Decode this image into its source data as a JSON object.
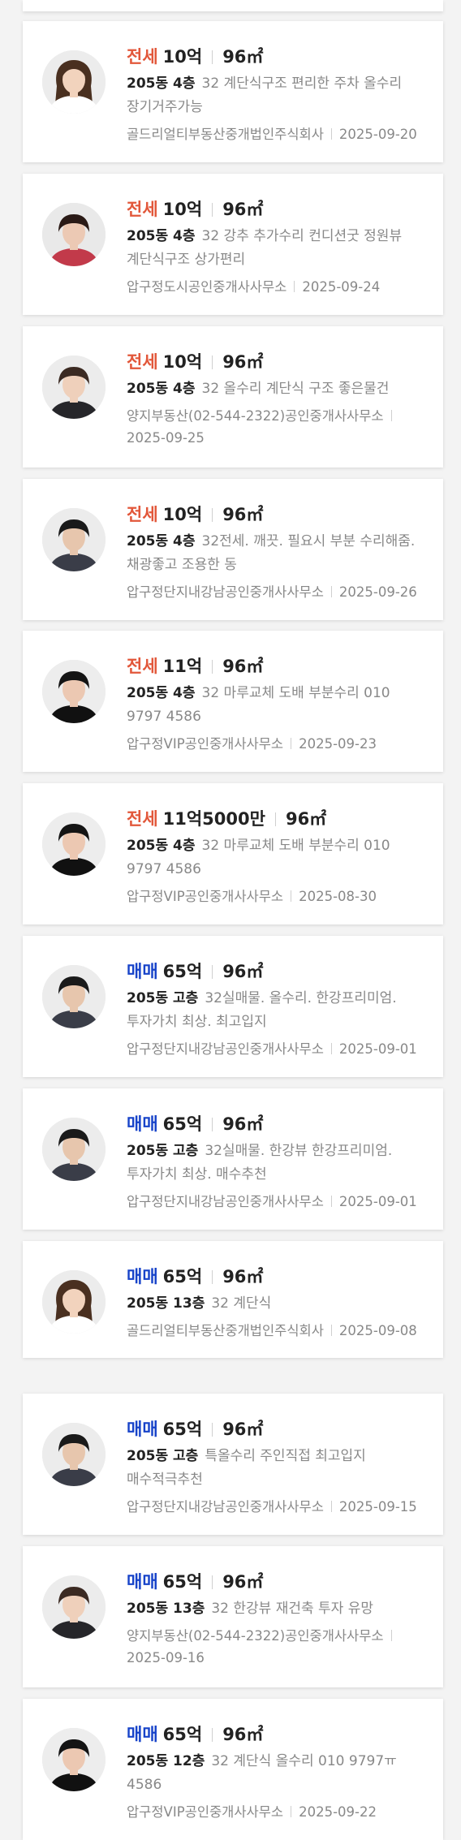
{
  "listings": [
    {
      "trade_type": "전세",
      "trade_kind": "jeonse",
      "price": "10억",
      "area": "96㎡",
      "floor": "205동 4층",
      "description": "32 계단식구조 편리한 주차 올수리 장기거주가능",
      "agency": "골드리얼티부동산중개법인주식회사",
      "date": "2025-09-20",
      "avatar": {
        "hair": "#4a3020",
        "skin": "#f2d3bd",
        "clothes": "#ffffff",
        "bg": "#ececec",
        "long_hair": true
      }
    },
    {
      "trade_type": "전세",
      "trade_kind": "jeonse",
      "price": "10억",
      "area": "96㎡",
      "floor": "205동 4층",
      "description": "32 강추 추가수리 컨디션굿 정원뷰 계단식구조 상가편리",
      "agency": "압구정도시공인중개사사무소",
      "date": "2025-09-24",
      "avatar": {
        "hair": "#2a1a16",
        "skin": "#ecc9b4",
        "clothes": "#c23a4a",
        "bg": "#e9e9e9",
        "long_hair": false
      }
    },
    {
      "trade_type": "전세",
      "trade_kind": "jeonse",
      "price": "10억",
      "area": "96㎡",
      "floor": "205동 4층",
      "description": "32 올수리 계단식 구조 좋은물건",
      "agency": "양지부동산(02-544-2322)공인중개사사무소",
      "date": "2025-09-25",
      "avatar": {
        "hair": "#3b2a22",
        "skin": "#efd0bb",
        "clothes": "#26262a",
        "bg": "#ececec",
        "long_hair": false
      }
    },
    {
      "trade_type": "전세",
      "trade_kind": "jeonse",
      "price": "10억",
      "area": "96㎡",
      "floor": "205동 4층",
      "description": "32전세. 깨끗. 필요시 부분 수리해줌. 채광좋고 조용한 동",
      "agency": "압구정단지내강남공인중개사사무소",
      "date": "2025-09-26",
      "avatar": {
        "hair": "#1a1a1a",
        "skin": "#e7c6ad",
        "clothes": "#3a3d48",
        "bg": "#ececec",
        "long_hair": false
      }
    },
    {
      "trade_type": "전세",
      "trade_kind": "jeonse",
      "price": "11억",
      "area": "96㎡",
      "floor": "205동 4층",
      "description": "32 마루교체 도배 부분수리 010 9797 4586",
      "agency": "압구정VIP공인중개사사무소",
      "date": "2025-09-23",
      "avatar": {
        "hair": "#141414",
        "skin": "#ecc8b2",
        "clothes": "#111111",
        "bg": "#ededed",
        "long_hair": false
      }
    },
    {
      "trade_type": "전세",
      "trade_kind": "jeonse",
      "price": "11억5000만",
      "area": "96㎡",
      "floor": "205동 4층",
      "description": "32 마루교체 도배 부분수리 010 9797 4586",
      "agency": "압구정VIP공인중개사사무소",
      "date": "2025-08-30",
      "avatar": {
        "hair": "#141414",
        "skin": "#ecc8b2",
        "clothes": "#111111",
        "bg": "#ededed",
        "long_hair": false
      }
    },
    {
      "trade_type": "매매",
      "trade_kind": "maemae",
      "price": "65억",
      "area": "96㎡",
      "floor": "205동 고층",
      "description": "32실매물. 올수리. 한강프리미엄. 투자가치 최상. 최고입지",
      "agency": "압구정단지내강남공인중개사사무소",
      "date": "2025-09-01",
      "avatar": {
        "hair": "#1a1a1a",
        "skin": "#e7c6ad",
        "clothes": "#3a3d48",
        "bg": "#ececec",
        "long_hair": false
      }
    },
    {
      "trade_type": "매매",
      "trade_kind": "maemae",
      "price": "65억",
      "area": "96㎡",
      "floor": "205동 고층",
      "description": "32실매물. 한강뷰 한강프리미엄. 투자가치 최상. 매수추천",
      "agency": "압구정단지내강남공인중개사사무소",
      "date": "2025-09-01",
      "avatar": {
        "hair": "#1a1a1a",
        "skin": "#e7c6ad",
        "clothes": "#3a3d48",
        "bg": "#ececec",
        "long_hair": false
      }
    },
    {
      "trade_type": "매매",
      "trade_kind": "maemae",
      "price": "65억",
      "area": "96㎡",
      "floor": "205동 13층",
      "description": "32 계단식",
      "agency": "골드리얼티부동산중개법인주식회사",
      "date": "2025-09-08",
      "avatar": {
        "hair": "#4a3020",
        "skin": "#f2d3bd",
        "clothes": "#ffffff",
        "bg": "#ececec",
        "long_hair": true
      }
    },
    {
      "trade_type": "매매",
      "trade_kind": "maemae",
      "price": "65억",
      "area": "96㎡",
      "floor": "205동 고층",
      "description": "특올수리 주인직접 최고입지 매수적극추천",
      "agency": "압구정단지내강남공인중개사사무소",
      "date": "2025-09-15",
      "avatar": {
        "hair": "#1a1a1a",
        "skin": "#e7c6ad",
        "clothes": "#3a3d48",
        "bg": "#ececec",
        "long_hair": false
      }
    },
    {
      "trade_type": "매매",
      "trade_kind": "maemae",
      "price": "65억",
      "area": "96㎡",
      "floor": "205동 13층",
      "description": "32 한강뷰 재건축 투자 유망",
      "agency": "양지부동산(02-544-2322)공인중개사사무소",
      "date": "2025-09-16",
      "avatar": {
        "hair": "#3b2a22",
        "skin": "#efd0bb",
        "clothes": "#26262a",
        "bg": "#ececec",
        "long_hair": false
      }
    },
    {
      "trade_type": "매매",
      "trade_kind": "maemae",
      "price": "65억",
      "area": "96㎡",
      "floor": "205동 12층",
      "description": "32 계단식 올수리 010 9797ㅠ 4586",
      "agency": "압구정VIP공인중개사사무소",
      "date": "2025-09-22",
      "avatar": {
        "hair": "#141414",
        "skin": "#ecc8b2",
        "clothes": "#111111",
        "bg": "#ededed",
        "long_hair": false
      }
    }
  ]
}
